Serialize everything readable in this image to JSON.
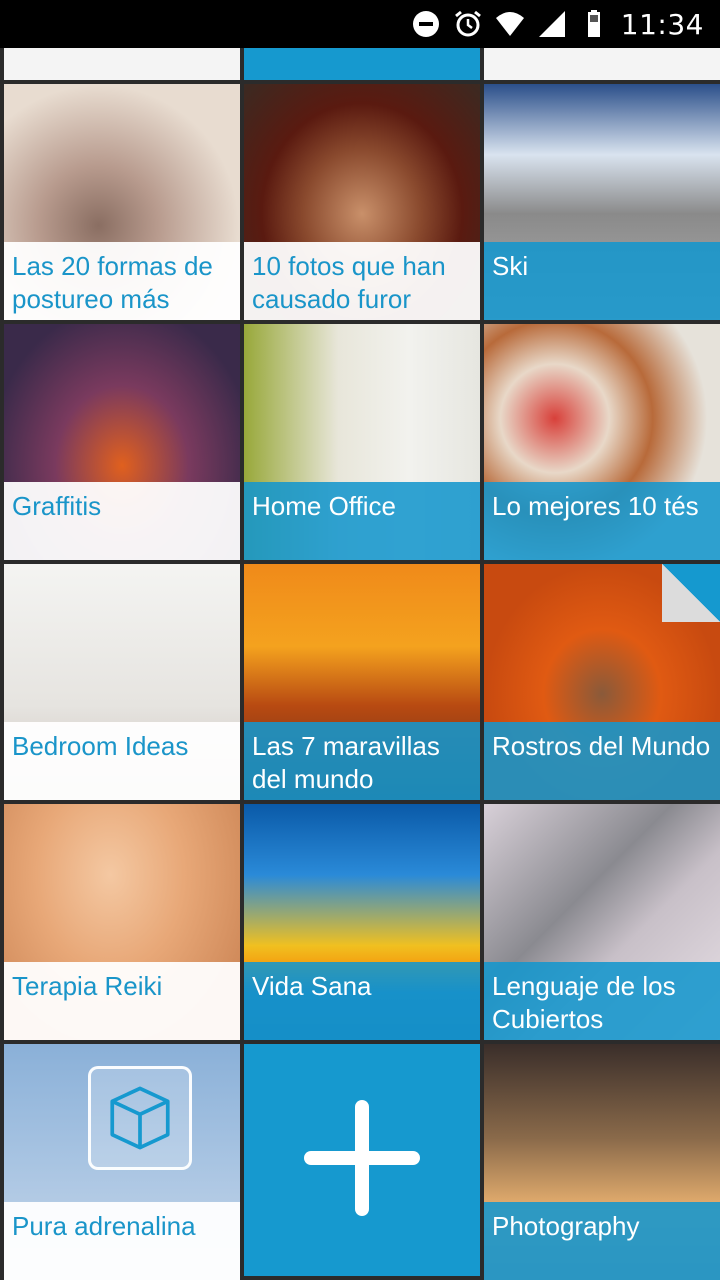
{
  "status_bar": {
    "time": "11:34",
    "icons": [
      "do-not-disturb-icon",
      "alarm-icon",
      "wifi-icon",
      "signal-icon",
      "battery-icon"
    ]
  },
  "colors": {
    "accent": "#1699cf",
    "caption_text_white_tiles": "#1a95c9",
    "background": "#2b2b2b"
  },
  "tiles": [
    {
      "label": "Las 20 formas de postureo más",
      "style": "white"
    },
    {
      "label": "10 fotos que han causado furor",
      "style": "white"
    },
    {
      "label": "Ski",
      "style": "blue"
    },
    {
      "label": "Graffitis",
      "style": "white"
    },
    {
      "label": "Home Office",
      "style": "blue"
    },
    {
      "label": "Lo mejores 10 tés",
      "style": "blue"
    },
    {
      "label": "Bedroom Ideas",
      "style": "white"
    },
    {
      "label": "Las 7 maravillas del mundo",
      "style": "blue"
    },
    {
      "label": "Rostros del Mundo",
      "style": "blue"
    },
    {
      "label": "Terapia Reiki",
      "style": "white"
    },
    {
      "label": "Vida Sana",
      "style": "blue"
    },
    {
      "label": "Lenguaje de los Cubiertos",
      "style": "blue"
    },
    {
      "label": "Pura adrenalina",
      "style": "white"
    },
    {
      "label": "Photography",
      "style": "blue"
    }
  ],
  "add_tile": {
    "icon": "plus-icon"
  }
}
